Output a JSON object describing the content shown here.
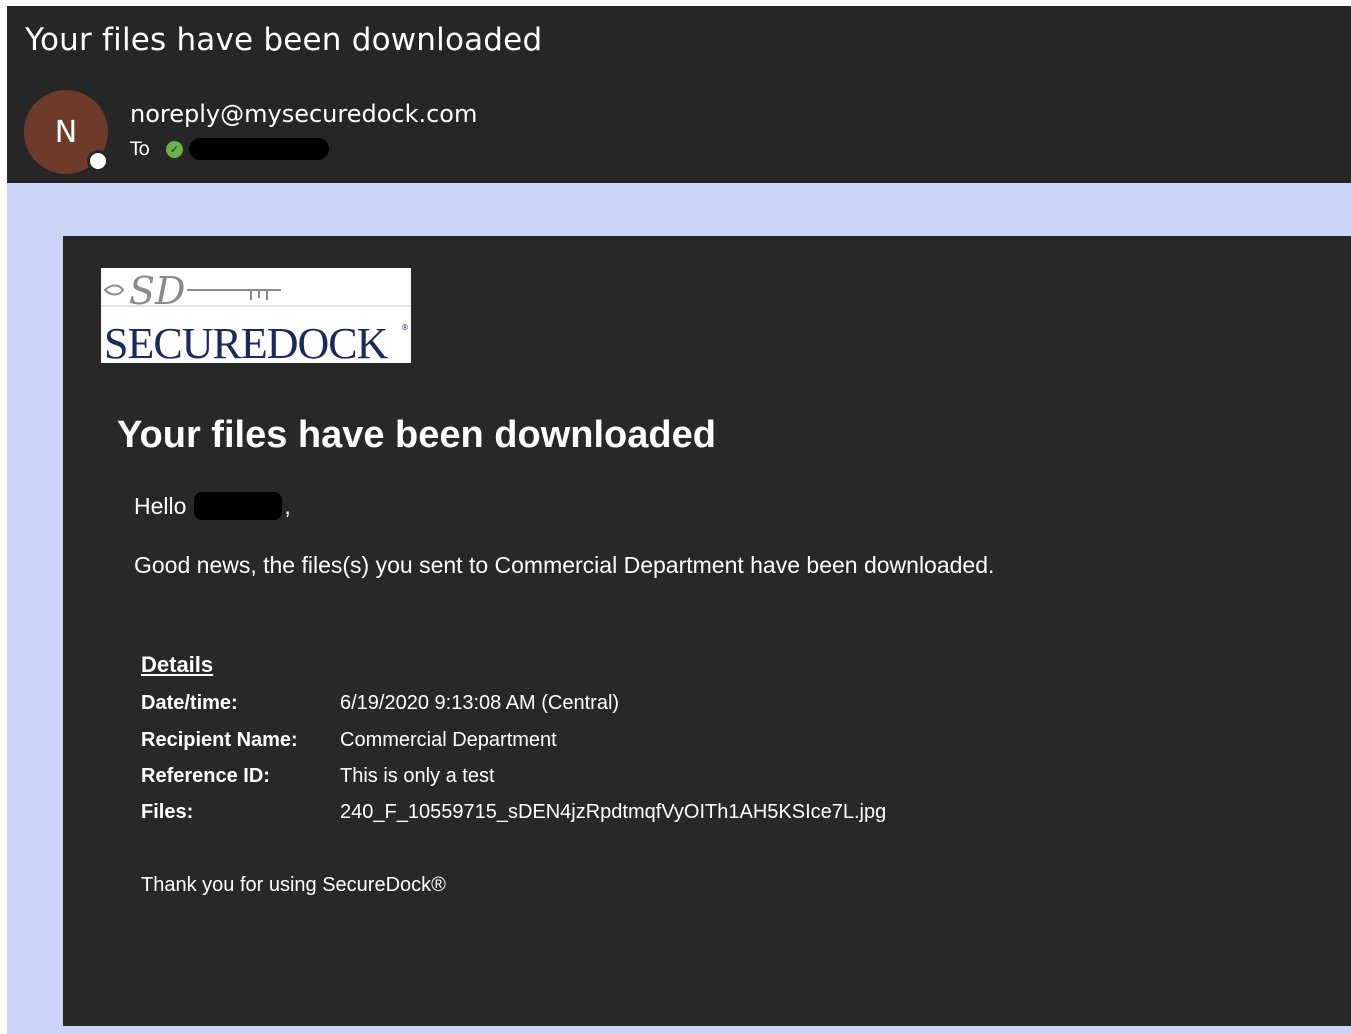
{
  "email": {
    "subject": "Your files have been downloaded",
    "avatar_initial": "N",
    "sender": "noreply@mysecuredock.com",
    "to_label": "To"
  },
  "logo": {
    "monogram": "SD",
    "wordmark": "SECUREDOCK"
  },
  "body": {
    "title": "Your files have been downloaded",
    "greeting": "Hello",
    "greeting_punct": ",",
    "message": "Good news, the files(s) you sent to Commercial  Department have been downloaded.",
    "details_heading": "Details",
    "details": [
      {
        "label": "Date/time:",
        "value": "6/19/2020 9:13:08 AM (Central)"
      },
      {
        "label": "Recipient Name:",
        "value": "Commercial Department"
      },
      {
        "label": "Reference ID:",
        "value": "This is only a test"
      },
      {
        "label": "Files:",
        "value": "240_F_10559715_sDEN4jzRpdtmqfVyOITh1AH5KSIce7L.jpg"
      }
    ],
    "thanks": "Thank you for using SecureDock®"
  },
  "colors": {
    "header_bg": "#262626",
    "outer_body_bg": "#cad5f7",
    "card_bg": "#282828",
    "avatar_bg": "#6e3b2a",
    "presence_check": "#6ab04c",
    "logo_navy": "#1b2a5c"
  }
}
